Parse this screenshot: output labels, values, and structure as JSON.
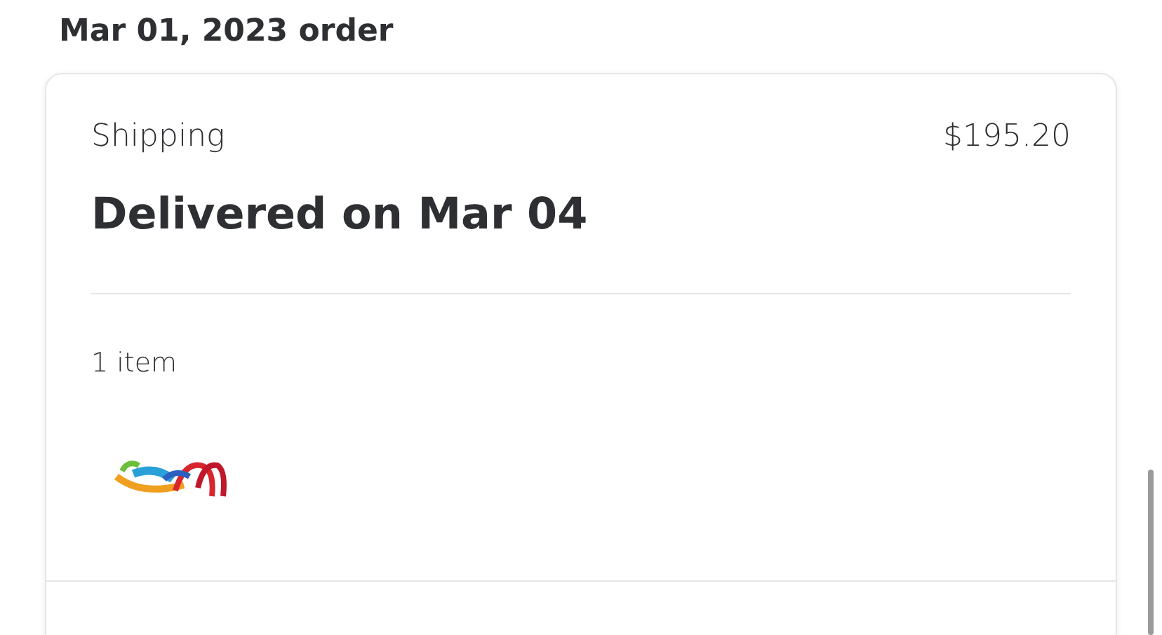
{
  "order_title": "Mar 01, 2023 order",
  "shipment": {
    "method": "Shipping",
    "total": "$195.20",
    "status": "Delivered on Mar 04",
    "item_count": "1 item"
  }
}
